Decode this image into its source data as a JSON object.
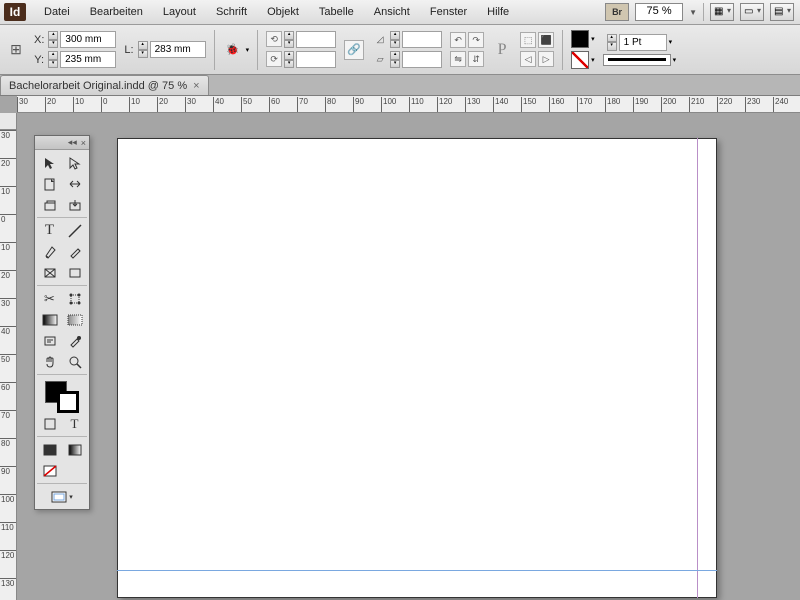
{
  "app": {
    "logo_text": "Id"
  },
  "menu": [
    "Datei",
    "Bearbeiten",
    "Layout",
    "Schrift",
    "Objekt",
    "Tabelle",
    "Ansicht",
    "Fenster",
    "Hilfe"
  ],
  "topbar": {
    "bridge_label": "Br",
    "zoom": "75 %"
  },
  "control": {
    "x": "300 mm",
    "y": "235 mm",
    "l": "283 mm",
    "stroke_weight": "1 Pt"
  },
  "document": {
    "tab_title": "Bachelorarbeit Original.indd @ 75 %"
  },
  "hruler_ticks": [
    30,
    20,
    10,
    0,
    10,
    20,
    30,
    40,
    50,
    60,
    70,
    80,
    90,
    100,
    110,
    120,
    130,
    140,
    150,
    160,
    170,
    180,
    190,
    200,
    210,
    220,
    230,
    240
  ],
  "vruler_ticks": [
    30,
    20,
    10,
    0,
    10,
    20,
    30,
    40,
    50,
    60,
    70,
    80,
    90,
    100,
    110,
    120,
    130
  ],
  "tools": {
    "names": [
      "selection",
      "direct-selection",
      "page",
      "gap",
      "content-collector",
      "content-placer",
      "type",
      "line",
      "pen",
      "pencil",
      "rectangle-frame",
      "rectangle",
      "scissors",
      "free-transform",
      "gradient-swatch",
      "gradient-feather",
      "note",
      "eyedropper",
      "hand",
      "zoom"
    ]
  }
}
